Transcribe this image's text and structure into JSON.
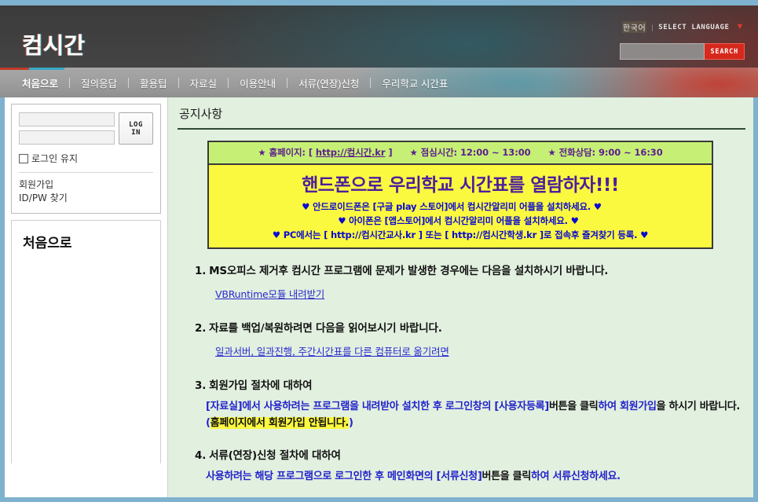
{
  "header": {
    "logo": "컴시간",
    "language_current": "한국어",
    "language_separator": "|",
    "language_select": "SELECT LANGUAGE",
    "caret_icon": "▼",
    "search_value": "",
    "search_placeholder": "",
    "search_button": "SEARCH"
  },
  "nav": {
    "items": [
      {
        "label": "처음으로",
        "active": true
      },
      {
        "label": "질의응답",
        "active": false
      },
      {
        "label": "활용팁",
        "active": false
      },
      {
        "label": "자료실",
        "active": false
      },
      {
        "label": "이용안내",
        "active": false
      },
      {
        "label": "서류(연장)신청",
        "active": false
      },
      {
        "label": "우리학교 시간표",
        "active": false
      }
    ]
  },
  "sidebar": {
    "login": {
      "id_value": "",
      "id_placeholder": "",
      "pw_value": "",
      "pw_placeholder": "",
      "login_button": "LOG IN",
      "keep_logged_in": "로그인 유지",
      "signup_link": "회원가입",
      "find_link": "ID/PW 찾기"
    },
    "panel_title": "처음으로"
  },
  "main": {
    "page_title": "공지사항",
    "info_bar": {
      "star": "★",
      "home_label": "홈페이지:",
      "home_open": "[",
      "home_url": "http://컴시간.kr",
      "home_close": "]",
      "lunch": "점심시간: 12:00 ~ 13:00",
      "phone": "전화상담: 9:00 ~ 16:30"
    },
    "banner": {
      "headline": "핸드폰으로 우리학교 시간표를 열람하자!!!",
      "heart": "♥",
      "line1": "♥ 안드로이드폰은 [구글 play 스토어]에서 컴시간알리미 어플을 설치하세요. ♥",
      "line2": "♥ 아이폰은 [앱스토어]에서 컴시간알리미 어플을 설치하세요. ♥",
      "line3": "♥ PC에서는 [ http://컴시간교사.kr ] 또는 [ http://컴시간학생.kr ]로 접속후 즐겨찾기 등록. ♥"
    },
    "items": [
      {
        "num": "1.",
        "title": "MS오피스 제거후 컴시간 프로그램에 문제가 발생한 경우에는 다음을 설치하시기 바랍니다.",
        "link": "VBRuntime모듈 내려받기"
      },
      {
        "num": "2.",
        "title": "자료를 백업/복원하려면 다음을 읽어보시기 바랍니다.",
        "link": "일과서버, 일과진행, 주간시간표를 다른 컴퓨터로 옮기려면"
      },
      {
        "num": "3.",
        "title": "회원가입 절차에 대하여",
        "body_a": "[자료실]에서 사용하려는 프로그램을 내려받아 설치한 후 로그인창의 [사용자등록]",
        "body_b": "버튼을 클릭",
        "body_c": "하여 회원가입",
        "body_d": "을 하시기 바랍니다. ",
        "body_paren_open": "(",
        "body_highlight": "홈페이지에서 회원가입 안됩니다.",
        "body_paren_close": ")"
      },
      {
        "num": "4.",
        "title": "서류(연장)신청 절차에 대하여",
        "body_a": "사용하려는 해당 프로그램으로 로그인한 후 메인화면의 [서류신청]",
        "body_b": "버튼을 클릭",
        "body_c": "하여 서류신청하세요."
      }
    ]
  },
  "colors": {
    "page_border": "#7fb2ce",
    "header_bg": "#3f3f3f",
    "accent_red": "#d6281c",
    "accent_teal": "#3ba7c4",
    "content_bg": "#e2f0df",
    "info_green": "#c6f075",
    "banner_yellow": "#fbf840",
    "purple": "#5b1f8c",
    "blue": "#2222cc"
  }
}
